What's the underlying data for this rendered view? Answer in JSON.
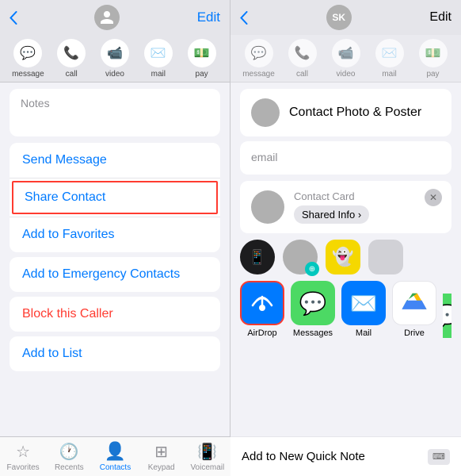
{
  "left": {
    "nav": {
      "back_label": "‹",
      "edit_label": "Edit"
    },
    "actions": [
      {
        "icon": "💬",
        "label": "message"
      },
      {
        "icon": "📞",
        "label": "call"
      },
      {
        "icon": "📹",
        "label": "video"
      },
      {
        "icon": "✉️",
        "label": "mail"
      },
      {
        "icon": "💵",
        "label": "pay"
      }
    ],
    "notes_label": "Notes",
    "menu_items": [
      {
        "label": "Send Message",
        "color": "blue",
        "highlight": false
      },
      {
        "label": "Share Contact",
        "color": "blue",
        "highlight": true
      },
      {
        "label": "Add to Favorites",
        "color": "blue",
        "highlight": false
      },
      {
        "label": "Add to Emergency Contacts",
        "color": "blue",
        "highlight": false
      },
      {
        "label": "Block this Caller",
        "color": "red",
        "highlight": false
      },
      {
        "label": "Add to List",
        "color": "blue",
        "highlight": false
      }
    ],
    "tabs": [
      {
        "icon": "★",
        "label": "Favorites",
        "active": false
      },
      {
        "icon": "🕐",
        "label": "Recents",
        "active": false
      },
      {
        "icon": "👤",
        "label": "Contacts",
        "active": true
      },
      {
        "icon": "⌨",
        "label": "Keypad",
        "active": false
      },
      {
        "icon": "📱",
        "label": "Voicemail",
        "active": false
      }
    ]
  },
  "right": {
    "nav": {
      "back_label": "‹",
      "sk_label": "SK",
      "edit_label": "Edit"
    },
    "actions": [
      {
        "icon": "💬",
        "label": "message"
      },
      {
        "icon": "📞",
        "label": "call"
      },
      {
        "icon": "📹",
        "label": "video"
      },
      {
        "icon": "✉️",
        "label": "mail"
      },
      {
        "icon": "💵",
        "label": "pay"
      }
    ],
    "photo_poster": {
      "label": "Contact Photo & Poster"
    },
    "email_label": "email",
    "contact_card": {
      "title": "Contact Card",
      "shared_info_label": "Shared Info ›"
    },
    "share_apps": [
      {
        "name": "phone-app",
        "icon": "📱",
        "bg": "#1c1c1e"
      },
      {
        "name": "snapchat-app",
        "icon": "👻",
        "bg": "#f5d800"
      },
      {
        "name": "blank-app",
        "icon": "",
        "bg": "#d1d1d6"
      }
    ],
    "share_buttons": [
      {
        "name": "airdrop",
        "label": "AirDrop",
        "bg": "#1c7fff",
        "highlight": true
      },
      {
        "name": "messages",
        "label": "Messages",
        "bg": "#4cd964",
        "highlight": false
      },
      {
        "name": "mail",
        "label": "Mail",
        "bg": "#007aff",
        "highlight": false
      },
      {
        "name": "drive",
        "label": "Drive",
        "bg": "#ffffff",
        "highlight": false
      },
      {
        "name": "extra",
        "label": "",
        "bg": "#4cd964",
        "highlight": false
      }
    ],
    "quick_note_label": "Add to New Quick Note"
  }
}
